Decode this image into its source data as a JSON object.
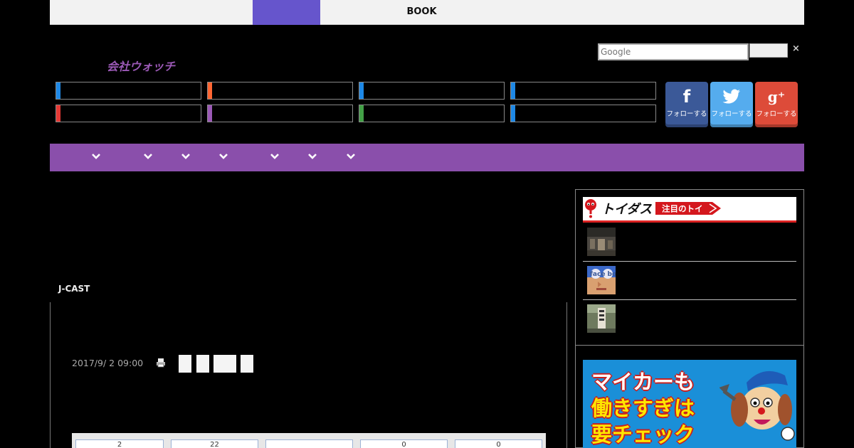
{
  "topbar": {
    "book_label": "BOOK"
  },
  "header": {
    "logo_text": "会社ウォッチ"
  },
  "search": {
    "placeholder": "Google",
    "close_glyph": "×"
  },
  "category_accents": [
    "#1e88e5",
    "#ff6633",
    "#1e88e5",
    "#1e88e5",
    "#e53935",
    "#9b59b6",
    "#43a047",
    "#1e88e5"
  ],
  "social": [
    {
      "name": "facebook",
      "glyph": "f",
      "label": "フォローする",
      "color": "#3b5998"
    },
    {
      "name": "twitter",
      "glyph": "🐦",
      "label": "フォローする",
      "color": "#55acee"
    },
    {
      "name": "google-plus",
      "glyph": "g⁺",
      "label": "フォローする",
      "color": "#dd4b39"
    }
  ],
  "nav": {
    "color": "#8a4fab"
  },
  "article": {
    "source": "J-CAST",
    "date": "2017/9/ 2 09:00",
    "tabs": [
      "2",
      "22",
      "",
      "0",
      "0"
    ]
  },
  "sidebar": {
    "toi_title": "トイダス",
    "toi_tag": "注目のトイ"
  },
  "ad": {
    "line1": "マイカーも",
    "line2": "働きすぎは",
    "line3": "要チェック"
  }
}
